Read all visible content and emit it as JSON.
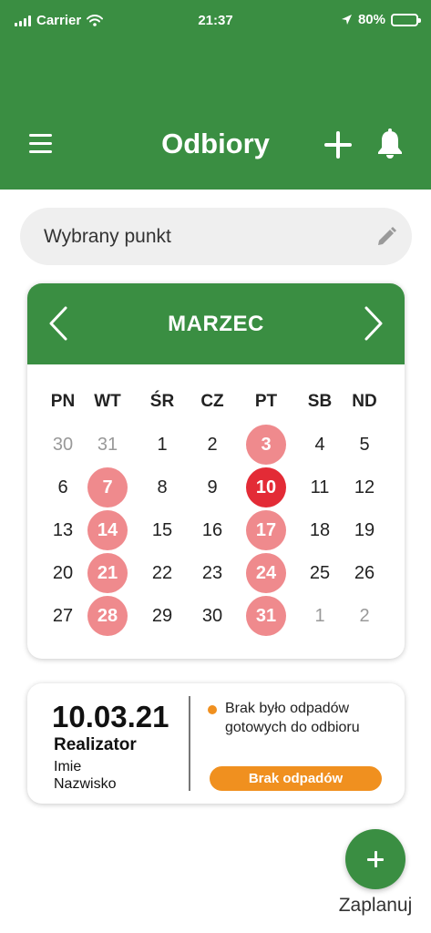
{
  "status_bar": {
    "carrier": "Carrier",
    "time": "21:37",
    "battery": "80%",
    "battery_level": 0.8
  },
  "header": {
    "title": "Odbiory",
    "icons": [
      "menu-icon",
      "plus-icon",
      "bell-icon"
    ]
  },
  "point_field": {
    "label": "Wybrany punkt",
    "icon": "pencil-icon"
  },
  "calendar": {
    "month": "MARZEC",
    "weekdays": [
      "PN",
      "WT",
      "ŚR",
      "CZ",
      "PT",
      "SB",
      "ND"
    ],
    "weeks": [
      [
        {
          "d": "30",
          "state": "muted"
        },
        {
          "d": "31",
          "state": "muted"
        },
        {
          "d": "1",
          "state": "normal"
        },
        {
          "d": "2",
          "state": "normal"
        },
        {
          "d": "3",
          "state": "event"
        },
        {
          "d": "4",
          "state": "normal"
        },
        {
          "d": "5",
          "state": "normal"
        }
      ],
      [
        {
          "d": "6",
          "state": "normal"
        },
        {
          "d": "7",
          "state": "event"
        },
        {
          "d": "8",
          "state": "normal"
        },
        {
          "d": "9",
          "state": "normal"
        },
        {
          "d": "10",
          "state": "today"
        },
        {
          "d": "11",
          "state": "normal"
        },
        {
          "d": "12",
          "state": "normal"
        }
      ],
      [
        {
          "d": "13",
          "state": "normal"
        },
        {
          "d": "14",
          "state": "event"
        },
        {
          "d": "15",
          "state": "normal"
        },
        {
          "d": "16",
          "state": "normal"
        },
        {
          "d": "17",
          "state": "event"
        },
        {
          "d": "18",
          "state": "normal"
        },
        {
          "d": "19",
          "state": "normal"
        }
      ],
      [
        {
          "d": "20",
          "state": "normal"
        },
        {
          "d": "21",
          "state": "event"
        },
        {
          "d": "22",
          "state": "normal"
        },
        {
          "d": "23",
          "state": "normal"
        },
        {
          "d": "24",
          "state": "event"
        },
        {
          "d": "25",
          "state": "normal"
        },
        {
          "d": "26",
          "state": "normal"
        }
      ],
      [
        {
          "d": "27",
          "state": "normal"
        },
        {
          "d": "28",
          "state": "event"
        },
        {
          "d": "29",
          "state": "normal"
        },
        {
          "d": "30",
          "state": "normal"
        },
        {
          "d": "31",
          "state": "event"
        },
        {
          "d": "1",
          "state": "muted"
        },
        {
          "d": "2",
          "state": "muted"
        }
      ]
    ]
  },
  "pickup_card": {
    "date": "10.03.21",
    "role": "Realizator",
    "first_name": "Imie",
    "last_name": "Nazwisko",
    "message": "Brak było odpadów gotowych do odbioru",
    "badge": "Brak odpadów"
  },
  "fab": {
    "label": "Zaplanuj"
  },
  "colors": {
    "primary_green": "#3a8e42",
    "event_pink": "#ef8a8d",
    "today_red": "#e32b36",
    "warning_orange": "#f0901f",
    "field_gray": "#efefef"
  }
}
